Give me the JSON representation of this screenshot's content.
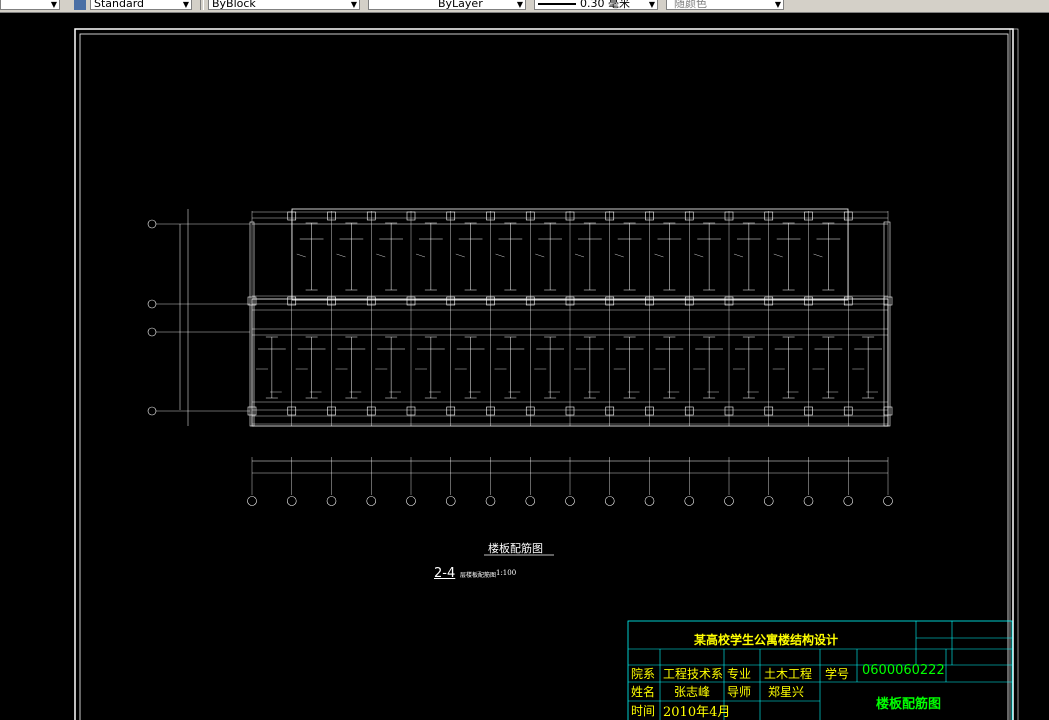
{
  "toolbar": {
    "text_style": "Standard",
    "color": "ByBlock",
    "linetype": "ByLayer",
    "lineweight": "0.30 毫米",
    "plot_style": "随颜色"
  },
  "drawing": {
    "title": "楼板配筋图",
    "subtitle_prefix": "2-4",
    "subtitle_rest": "层楼板配筋图",
    "scale": "1:100",
    "row_axes": [
      "A",
      "B",
      "C",
      "D"
    ],
    "col_axes": [
      "1",
      "2",
      "3",
      "4",
      "5",
      "6",
      "7",
      "8",
      "9",
      "10",
      "11",
      "12",
      "13",
      "14",
      "15",
      "16",
      "17"
    ],
    "colors": {
      "lines": "#ffffff",
      "frame": "#ffffff",
      "title_block": "#00ffff",
      "title_text": "#00ff00",
      "title_accent": "#ffff00"
    }
  },
  "title_block": {
    "project": "某高校学生公寓楼结构设计",
    "dept_label": "院系",
    "dept_value": "工程技术系",
    "major_label": "专业",
    "major_value": "土木工程",
    "id_label": "学号",
    "id_value": "0600060222",
    "name_label": "姓名",
    "name_value": "张志峰",
    "advisor_label": "导师",
    "advisor_value": "郑星兴",
    "date_label": "时间",
    "date_value": "2010年4月",
    "sheet_title": "楼板配筋图"
  }
}
